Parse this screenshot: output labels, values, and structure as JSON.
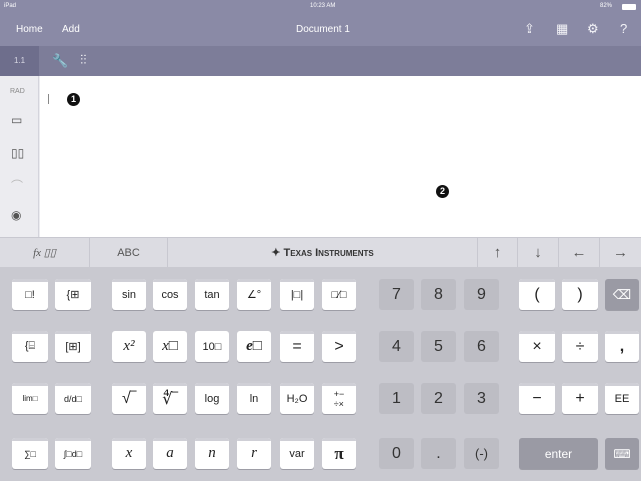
{
  "status_bar": {
    "device": "iPad",
    "time": "10:23 AM",
    "battery": "82%"
  },
  "title_bar": {
    "home": "Home",
    "add": "Add",
    "document_title": "Document 1",
    "help": "?"
  },
  "toolbar": {
    "page_tab": "1.1"
  },
  "sidebar": {
    "angle_mode": "RAD"
  },
  "work_area": {
    "callout_1": "1",
    "callout_2": "2"
  },
  "keyboard_tabs": {
    "fx": "fx",
    "abc": "ABC",
    "brand": "Texas Instruments"
  },
  "keys": {
    "r1": [
      "sin",
      "cos",
      "tan",
      "7",
      "8",
      "9",
      "(",
      ")"
    ],
    "r2": [
      "=",
      ">",
      "4",
      "5",
      "6",
      "×",
      "÷",
      ","
    ],
    "r3": [
      "log",
      "ln",
      "1",
      "2",
      "3",
      "−",
      "+",
      "EE"
    ],
    "r4": [
      "x",
      "a",
      "n",
      "r",
      "var",
      "π",
      "0",
      ".",
      "(-)",
      "enter"
    ],
    "pow2": "x²",
    "pow_box": "x□",
    "ten_pow": "10□",
    "e_pow": "e□",
    "h2o": "H₂O",
    "lim": "lim□",
    "deriv": "d/d□"
  },
  "colors": {
    "chrome": "#8a8aa6",
    "keyboard": "#c9c9d0",
    "enter": "#9a9aa4"
  }
}
